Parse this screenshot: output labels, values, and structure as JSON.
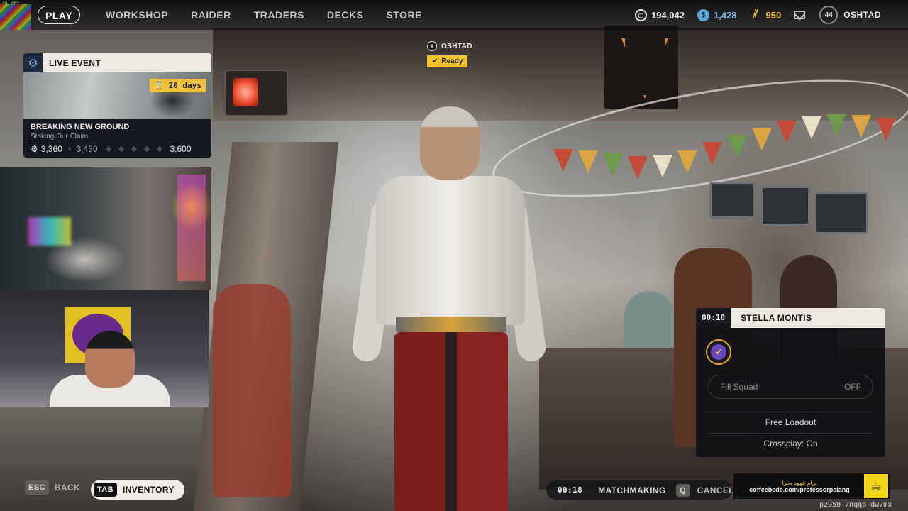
{
  "fps": "74 FPS",
  "nav": {
    "items": [
      {
        "label": "PLAY",
        "active": true
      },
      {
        "label": "WORKSHOP",
        "active": false
      },
      {
        "label": "RAIDER",
        "active": false
      },
      {
        "label": "TRADERS",
        "active": false
      },
      {
        "label": "DECKS",
        "active": false
      },
      {
        "label": "STORE",
        "active": false
      }
    ]
  },
  "currency": {
    "coins": "194,042",
    "credits": "1,428",
    "raider_tokens": "950"
  },
  "player": {
    "level": "44",
    "name": "OSHTAD"
  },
  "live_event": {
    "header": "LIVE EVENT",
    "days": "20 days",
    "name": "BREAKING NEW GROUND",
    "subtitle": "Staking Our Claim",
    "current": "3,360",
    "next": "3,450",
    "max": "3,600"
  },
  "lobby": {
    "name": "OSHTAD",
    "status": "Ready"
  },
  "squad": {
    "timer": "00:18",
    "name": "STELLA MONTIS",
    "fill_label": "Fill Squad",
    "fill_value": "OFF",
    "free_loadout": "Free Loadout",
    "crossplay": "Crossplay: On"
  },
  "footer": {
    "back_key": "ESC",
    "back_label": "BACK",
    "inventory_key": "TAB",
    "inventory_label": "INVENTORY",
    "match_timer": "00:18",
    "matchmaking_label": "MATCHMAKING",
    "cancel_key": "Q",
    "cancel_label": "CANCEL"
  },
  "promo": {
    "line1": "برام قهوه بخرا",
    "line2": "coffeebede.com/professorpalang"
  },
  "session_id": "p2958-7nqqp-dw7mx",
  "colors": {
    "accent_yellow": "#f2c32f",
    "panel_light": "#ece9e2",
    "panel_dark": "#141820"
  },
  "icons": {
    "coin": "coin-icon",
    "credit": "credit-icon",
    "raider_token": "raider-token-icon",
    "mail": "mail-icon",
    "event": "gear-icon",
    "promo": "coffee-cup-icon"
  }
}
